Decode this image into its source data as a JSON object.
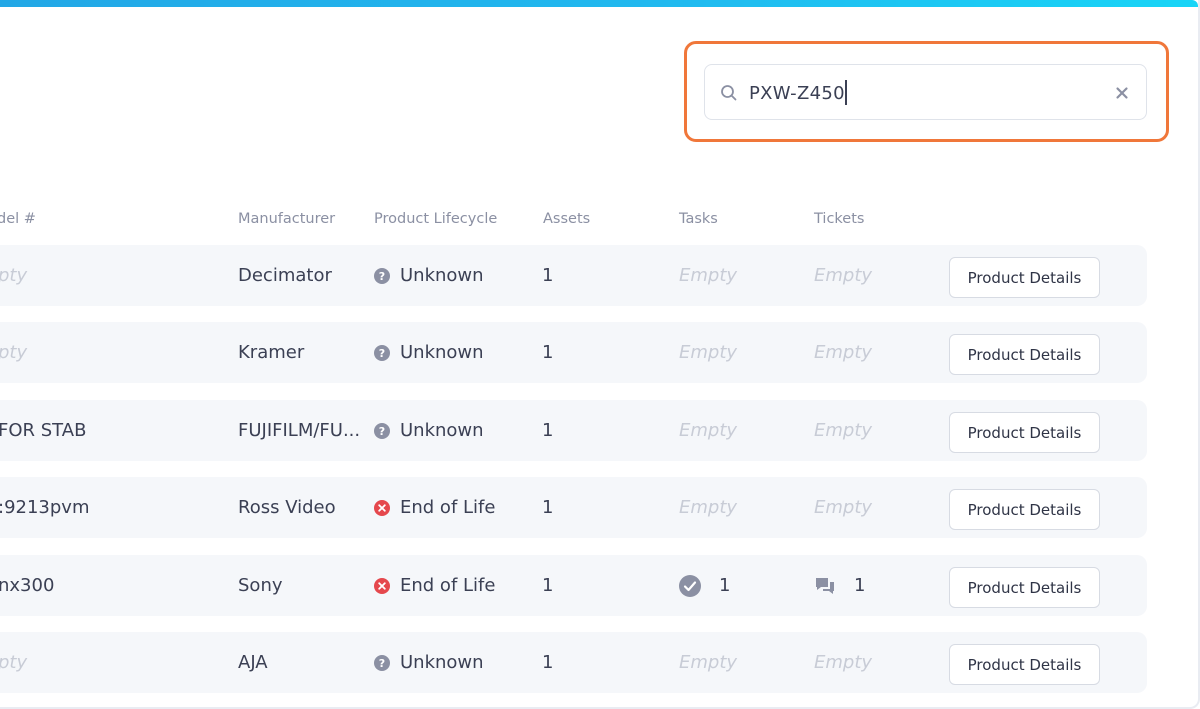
{
  "search": {
    "value": "PXW-Z450"
  },
  "columns": {
    "model": "del #",
    "manufacturer": "Manufacturer",
    "lifecycle": "Product Lifecycle",
    "assets": "Assets",
    "tasks": "Tasks",
    "tickets": "Tickets"
  },
  "rows": [
    {
      "model": "pty",
      "model_empty": true,
      "manufacturer": "Decimator",
      "lifecycle": "Unknown",
      "lifecycle_status": "unknown",
      "assets": "1",
      "tasks": "Empty",
      "tasks_empty": true,
      "tickets": "Empty",
      "tickets_empty": true,
      "button": "Product Details"
    },
    {
      "model": "pty",
      "model_empty": true,
      "manufacturer": "Kramer",
      "lifecycle": "Unknown",
      "lifecycle_status": "unknown",
      "assets": "1",
      "tasks": "Empty",
      "tasks_empty": true,
      "tickets": "Empty",
      "tickets_empty": true,
      "button": "Product Details"
    },
    {
      "model": "FOR STAB",
      "model_empty": false,
      "manufacturer": "FUJIFILM/FU...",
      "lifecycle": "Unknown",
      "lifecycle_status": "unknown",
      "assets": "1",
      "tasks": "Empty",
      "tasks_empty": true,
      "tickets": "Empty",
      "tickets_empty": true,
      "button": "Product Details"
    },
    {
      "model": ":9213pvm",
      "model_empty": false,
      "manufacturer": "Ross Video",
      "lifecycle": "End of Life",
      "lifecycle_status": "eol",
      "assets": "1",
      "tasks": "Empty",
      "tasks_empty": true,
      "tickets": "Empty",
      "tickets_empty": true,
      "button": "Product Details"
    },
    {
      "model": "nx300",
      "model_empty": false,
      "manufacturer": "Sony",
      "lifecycle": "End of Life",
      "lifecycle_status": "eol",
      "assets": "1",
      "tasks": "1",
      "tasks_empty": false,
      "tickets": "1",
      "tickets_empty": false,
      "button": "Product Details"
    },
    {
      "model": "pty",
      "model_empty": true,
      "manufacturer": "AJA",
      "lifecycle": "Unknown",
      "lifecycle_status": "unknown",
      "assets": "1",
      "tasks": "Empty",
      "tasks_empty": true,
      "tickets": "Empty",
      "tickets_empty": true,
      "button": "Product Details"
    }
  ],
  "icons": {
    "search": "search-icon",
    "clear": "close-icon",
    "unknown": "question-circle-icon",
    "eol": "x-circle-icon",
    "task": "check-circle-icon",
    "ticket": "chat-bubbles-icon"
  },
  "colors": {
    "accent_bar": "#21b9ef",
    "highlight": "#f0773a",
    "eol": "#e5484d",
    "unknown": "#8b90a3",
    "muted_icon": "#8b90a3"
  }
}
